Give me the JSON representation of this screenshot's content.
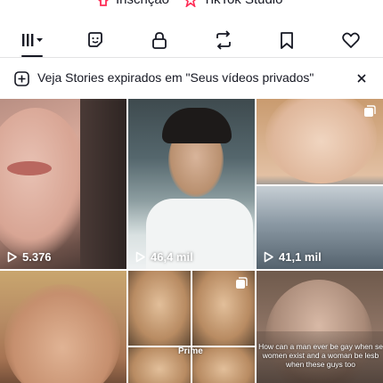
{
  "top_links": {
    "inscricao": "Inscrição",
    "tiktok_studio": "TikTok Studio"
  },
  "tabs": [
    {
      "name": "videos",
      "icon": "grid-menu-icon",
      "active": true
    },
    {
      "name": "stickers",
      "icon": "sticker-icon",
      "active": false
    },
    {
      "name": "private",
      "icon": "lock-icon",
      "active": false
    },
    {
      "name": "reposts",
      "icon": "repost-icon",
      "active": false
    },
    {
      "name": "favorites",
      "icon": "bookmark-icon",
      "active": false
    },
    {
      "name": "liked",
      "icon": "heart-icon",
      "active": false
    }
  ],
  "banner": {
    "text": "Veja Stories expirados em \"Seus vídeos privados\"",
    "icon": "add-circle-icon",
    "close_icon": "close-icon"
  },
  "videos": [
    {
      "views": "5.376",
      "multi": false
    },
    {
      "views": "46,4 mil",
      "multi": false
    },
    {
      "views": "41,1 mil",
      "multi": true
    },
    {
      "views": "",
      "multi": false
    },
    {
      "views": "",
      "multi": true,
      "overlay_text": "Prime"
    },
    {
      "views": "",
      "multi": false,
      "overlay_text": "How can a man ever be gay when se women exist and a woman be lesb when these guys too"
    }
  ],
  "colors": {
    "text": "#161823",
    "divider": "#e3e3e4",
    "tiktok_pink": "#fe2c55"
  }
}
